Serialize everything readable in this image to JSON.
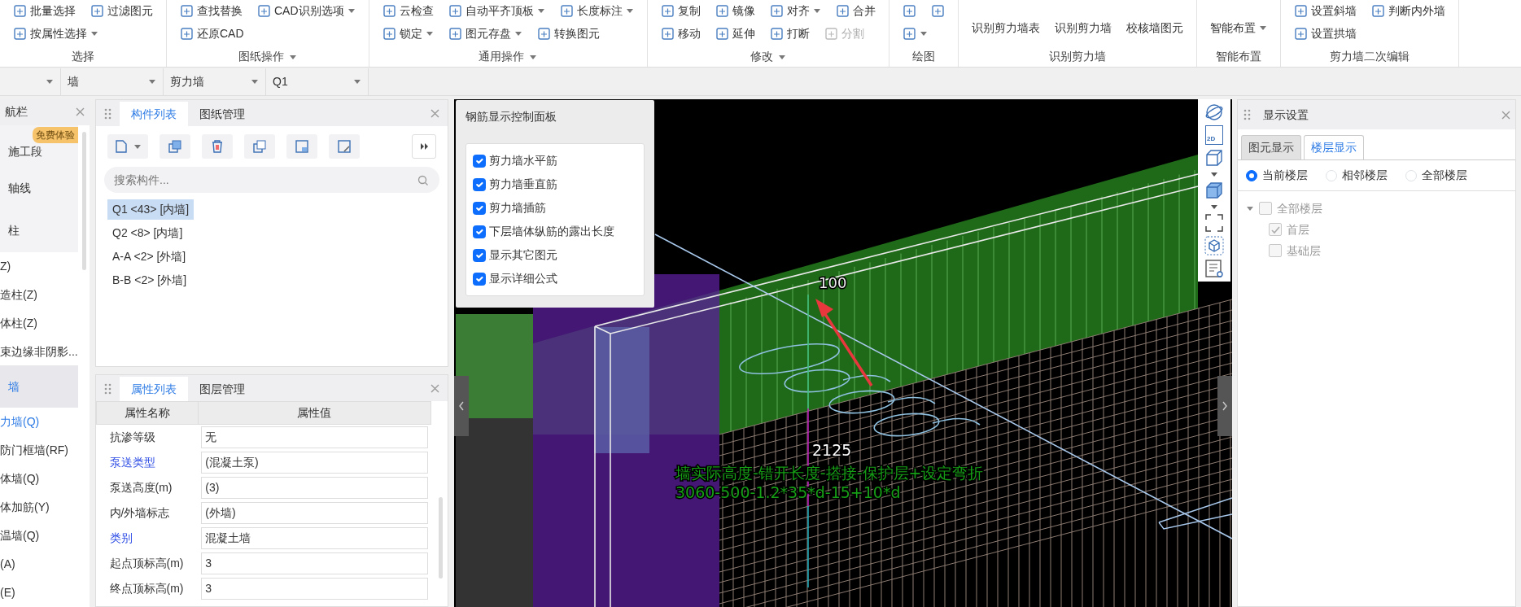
{
  "ribbon": {
    "groups": [
      {
        "label": "选择",
        "dropdown": false,
        "kind": "small",
        "rows": [
          [
            {
              "text": "批量选择",
              "dropdown": false,
              "disabled": false
            },
            {
              "text": "过滤图元",
              "dropdown": false,
              "disabled": false
            }
          ],
          [
            {
              "text": "按属性选择",
              "dropdown": true,
              "disabled": false
            }
          ]
        ]
      },
      {
        "label": "图纸操作",
        "dropdown": true,
        "kind": "small",
        "rows": [
          [
            {
              "text": "查找替换",
              "dropdown": false,
              "disabled": false
            },
            {
              "text": "CAD识别选项",
              "dropdown": true,
              "disabled": false
            }
          ],
          [
            {
              "text": "还原CAD",
              "dropdown": false,
              "disabled": false
            }
          ]
        ]
      },
      {
        "label": "通用操作",
        "dropdown": true,
        "kind": "small",
        "rows": [
          [
            {
              "text": "云检查",
              "dropdown": false,
              "disabled": false
            },
            {
              "text": "自动平齐顶板",
              "dropdown": true,
              "disabled": false
            },
            {
              "text": "长度标注",
              "dropdown": true,
              "disabled": false
            }
          ],
          [
            {
              "text": "锁定",
              "dropdown": true,
              "disabled": false
            },
            {
              "text": "图元存盘",
              "dropdown": true,
              "disabled": false
            },
            {
              "text": "转换图元",
              "dropdown": false,
              "disabled": false
            }
          ]
        ]
      },
      {
        "label": "修改",
        "dropdown": true,
        "kind": "small",
        "rows": [
          [
            {
              "text": "复制",
              "dropdown": false,
              "disabled": false
            },
            {
              "text": "镜像",
              "dropdown": false,
              "disabled": false
            },
            {
              "text": "对齐",
              "dropdown": true,
              "disabled": false
            },
            {
              "text": "合并",
              "dropdown": false,
              "disabled": false
            }
          ],
          [
            {
              "text": "移动",
              "dropdown": false,
              "disabled": false
            },
            {
              "text": "延伸",
              "dropdown": false,
              "disabled": false
            },
            {
              "text": "打断",
              "dropdown": false,
              "disabled": false
            },
            {
              "text": "分割",
              "dropdown": false,
              "disabled": true
            }
          ]
        ]
      },
      {
        "label": "绘图",
        "dropdown": false,
        "kind": "small",
        "rows": [
          [
            {
              "dropdown": false,
              "disabled": false
            },
            {
              "dropdown": false,
              "disabled": false
            }
          ],
          [
            {
              "dropdown": true,
              "disabled": false
            }
          ]
        ]
      },
      {
        "label": "识别剪力墙",
        "dropdown": false,
        "kind": "large",
        "rows": [
          [
            {
              "text": "识别剪力墙表",
              "dropdown": false,
              "disabled": false
            },
            {
              "text": "识别剪力墙",
              "dropdown": false,
              "disabled": false
            },
            {
              "text": "校核墙图元",
              "dropdown": false,
              "disabled": false
            }
          ]
        ]
      },
      {
        "label": "智能布置",
        "dropdown": false,
        "kind": "large",
        "rows": [
          [
            {
              "text": "智能布置",
              "dropdown": true,
              "disabled": false
            }
          ]
        ]
      },
      {
        "label": "剪力墙二次编辑",
        "dropdown": false,
        "kind": "small",
        "rows": [
          [
            {
              "text": "设置斜墙",
              "dropdown": false,
              "disabled": false
            },
            {
              "text": "判断内外墙",
              "dropdown": false,
              "disabled": false
            }
          ],
          [
            {
              "text": "设置拱墙",
              "dropdown": false,
              "disabled": false
            }
          ]
        ]
      }
    ]
  },
  "selectors": [
    {
      "value": "墙"
    },
    {
      "value": "剪力墙"
    },
    {
      "value": "Q1"
    }
  ],
  "nav": {
    "title": "航栏",
    "items": [
      {
        "kind": "group",
        "label": "施工段",
        "selected": false,
        "badge": "免费体验"
      },
      {
        "kind": "group",
        "label": "轴线",
        "selected": false
      },
      {
        "kind": "group",
        "label": "柱",
        "selected": false
      },
      {
        "kind": "item",
        "label": "Z)",
        "selected": false
      },
      {
        "kind": "item",
        "label": "造柱(Z)",
        "selected": false
      },
      {
        "kind": "item",
        "label": "体柱(Z)",
        "selected": false
      },
      {
        "kind": "item",
        "label": "束边缘非阴影...",
        "selected": false
      },
      {
        "kind": "group",
        "label": "墙",
        "selected": true
      },
      {
        "kind": "item",
        "label": "力墙(Q)",
        "selected": true
      },
      {
        "kind": "item",
        "label": "防门框墙(RF)",
        "selected": false
      },
      {
        "kind": "item",
        "label": "体墙(Q)",
        "selected": false
      },
      {
        "kind": "item",
        "label": "体加筋(Y)",
        "selected": false
      },
      {
        "kind": "item",
        "label": "温墙(Q)",
        "selected": false
      },
      {
        "kind": "item",
        "label": "(A)",
        "selected": false
      },
      {
        "kind": "item",
        "label": "(E)",
        "selected": false
      }
    ]
  },
  "component_panel": {
    "tabs": [
      {
        "label": "构件列表",
        "selected": true
      },
      {
        "label": "图纸管理",
        "selected": false
      }
    ],
    "search": {
      "placeholder": "搜索构件..."
    },
    "items": [
      {
        "label": "Q1 <43> [内墙]",
        "selected": true
      },
      {
        "label": "Q2 <8> [内墙]",
        "selected": false
      },
      {
        "label": "A-A <2> [外墙]",
        "selected": false
      },
      {
        "label": "B-B <2> [外墙]",
        "selected": false
      }
    ]
  },
  "property_panel": {
    "tabs": [
      {
        "label": "属性列表",
        "selected": true
      },
      {
        "label": "图层管理",
        "selected": false
      }
    ],
    "columns": [
      "属性名称",
      "属性值"
    ],
    "rows": [
      {
        "name": "抗渗等级",
        "value": "无",
        "highlighted": false
      },
      {
        "name": "泵送类型",
        "value": "(混凝土泵)",
        "highlighted": true
      },
      {
        "name": "泵送高度(m)",
        "value": "(3)",
        "highlighted": false
      },
      {
        "name": "内/外墙标志",
        "value": "(外墙)",
        "highlighted": false
      },
      {
        "name": "类别",
        "value": "混凝土墙",
        "highlighted": true
      },
      {
        "name": "起点顶标高(m)",
        "value": "3",
        "highlighted": false
      },
      {
        "name": "终点顶标高(m)",
        "value": "3",
        "highlighted": false
      }
    ]
  },
  "rebar_panel": {
    "title": "钢筋显示控制面板",
    "options": [
      {
        "label": "剪力墙水平筋",
        "checked": true
      },
      {
        "label": "剪力墙垂直筋",
        "checked": true
      },
      {
        "label": "剪力墙插筋",
        "checked": true
      },
      {
        "label": "下层墙体纵筋的露出长度",
        "checked": true
      },
      {
        "label": "显示其它图元",
        "checked": true
      },
      {
        "label": "显示详细公式",
        "checked": true
      }
    ]
  },
  "scene": {
    "top_label": "100",
    "length_label": "2125",
    "formula_lines": [
      "墙实际高度-错开长度-搭接-保护层+设定弯折",
      "3060-500-1.2*35*d-15+10*d"
    ]
  },
  "view_toolbar": {
    "label_2d": "2D"
  },
  "display_panel": {
    "title": "显示设置",
    "tabs": [
      {
        "label": "图元显示",
        "selected": false
      },
      {
        "label": "楼层显示",
        "selected": true
      }
    ],
    "radios": [
      {
        "label": "当前楼层",
        "selected": true
      },
      {
        "label": "相邻楼层",
        "selected": false
      },
      {
        "label": "全部楼层",
        "selected": false
      }
    ],
    "tree": [
      {
        "label": "全部楼层",
        "checked": false,
        "expanded": true,
        "disabled": true,
        "children": [
          {
            "label": "首层",
            "checked": true,
            "disabled": true
          },
          {
            "label": "基础层",
            "checked": false,
            "disabled": true
          }
        ]
      }
    ]
  }
}
